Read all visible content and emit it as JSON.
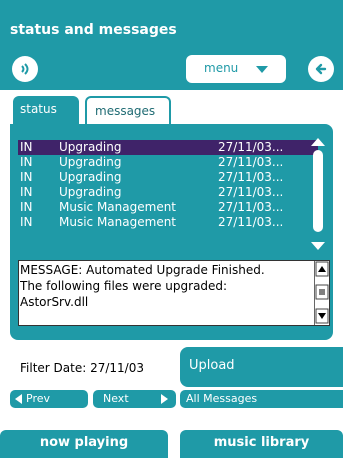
{
  "window": {
    "title": "status and messages"
  },
  "menu": {
    "label": "menu"
  },
  "tabs": [
    {
      "label": "status"
    },
    {
      "label": "messages"
    }
  ],
  "messages": [
    {
      "dir": "IN",
      "name": "Upgrading",
      "date": "27/11/03..."
    },
    {
      "dir": "IN",
      "name": "Upgrading",
      "date": "27/11/03..."
    },
    {
      "dir": "IN",
      "name": "Upgrading",
      "date": "27/11/03..."
    },
    {
      "dir": "IN",
      "name": "Upgrading",
      "date": "27/11/03..."
    },
    {
      "dir": "IN",
      "name": "Music Management",
      "date": "27/11/03..."
    },
    {
      "dir": "IN",
      "name": "Music Management",
      "date": "27/11/03..."
    }
  ],
  "message_detail": {
    "line1": "MESSAGE: Automated Upgrade Finished.",
    "line2": "The following files were upgraded:",
    "line3": "AstorSrv.dll"
  },
  "filter": {
    "label": "Filter Date: 27/11/03"
  },
  "buttons": {
    "upload": "Upload",
    "prev": "Prev",
    "next": "Next",
    "all_messages": "All Messages",
    "now_playing": "now playing",
    "music_library": "music library"
  },
  "colors": {
    "accent": "#1f9aa7",
    "selected_row": "#3f2369"
  }
}
